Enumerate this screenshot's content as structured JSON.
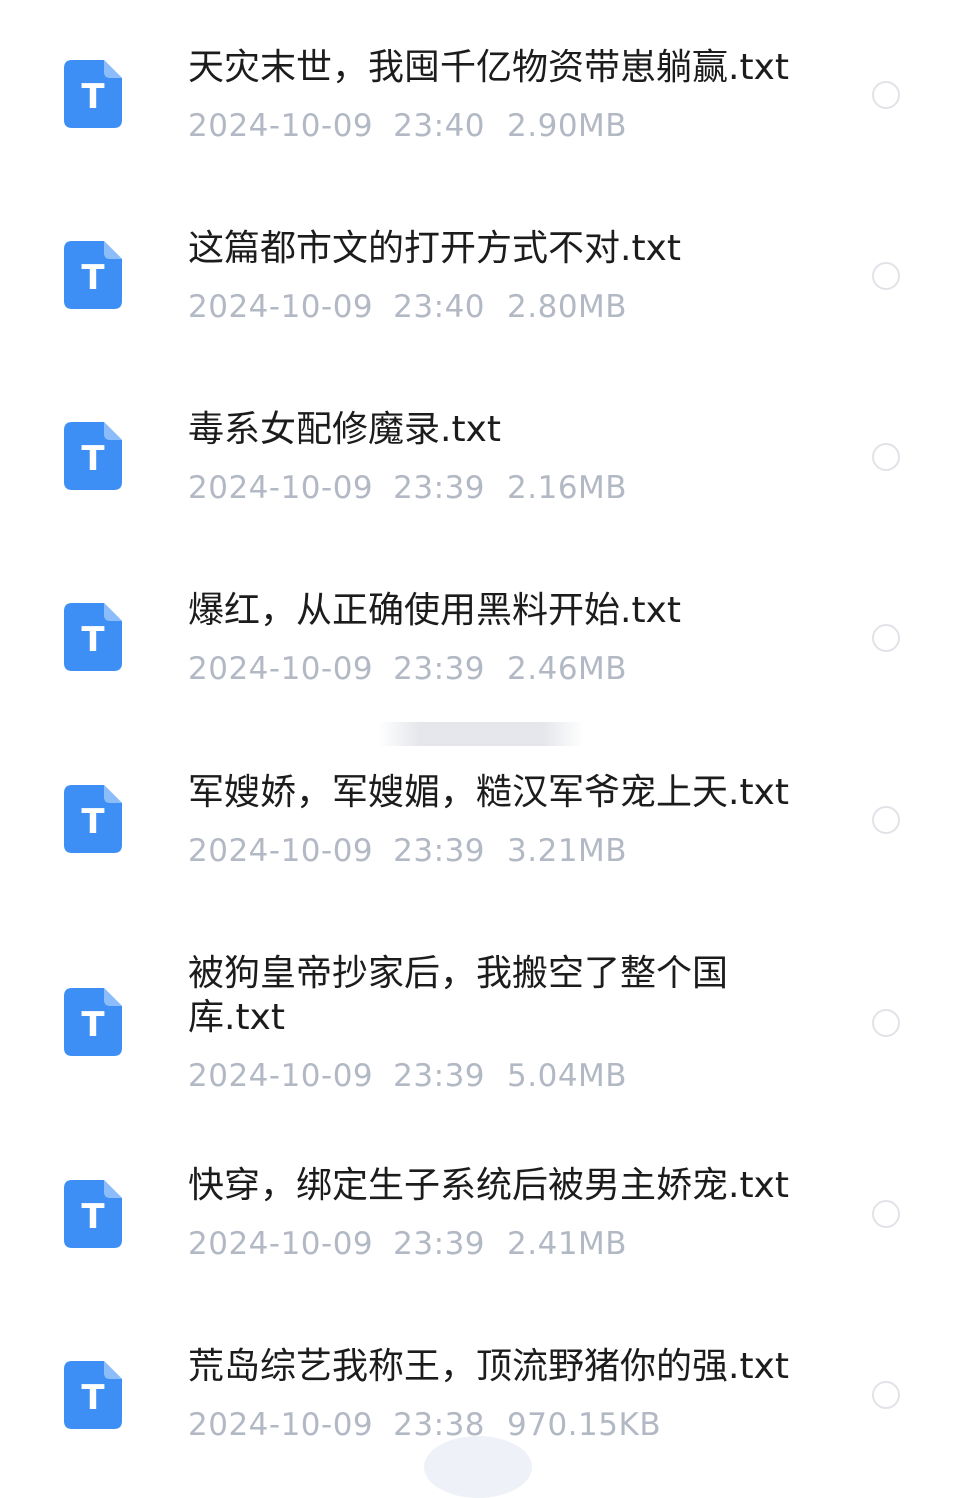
{
  "files": [
    {
      "name": "天灾末世，我囤千亿物资带崽躺赢.txt",
      "date": "2024-10-09",
      "time": "23:40",
      "size": "2.90MB",
      "icon": "txt-file-icon"
    },
    {
      "name": "这篇都市文的打开方式不对.txt",
      "date": "2024-10-09",
      "time": "23:40",
      "size": "2.80MB",
      "icon": "txt-file-icon"
    },
    {
      "name": "毒系女配修魔录.txt",
      "date": "2024-10-09",
      "time": "23:39",
      "size": "2.16MB",
      "icon": "txt-file-icon"
    },
    {
      "name": "爆红，从正确使用黑料开始.txt",
      "date": "2024-10-09",
      "time": "23:39",
      "size": "2.46MB",
      "icon": "txt-file-icon"
    },
    {
      "name": "军嫂娇，军嫂媚，糙汉军爷宠上天.txt",
      "date": "2024-10-09",
      "time": "23:39",
      "size": "3.21MB",
      "icon": "txt-file-icon"
    },
    {
      "name": "被狗皇帝抄家后，我搬空了整个国库.txt",
      "date": "2024-10-09",
      "time": "23:39",
      "size": "5.04MB",
      "icon": "txt-file-icon"
    },
    {
      "name": "快穿，绑定生子系统后被男主娇宠.txt",
      "date": "2024-10-09",
      "time": "23:39",
      "size": "2.41MB",
      "icon": "txt-file-icon"
    },
    {
      "name": "荒岛综艺我称王，顶流野猪你的强.txt",
      "date": "2024-10-09",
      "time": "23:38",
      "size": "970.15KB",
      "icon": "txt-file-icon"
    }
  ],
  "icon_glyph": "T",
  "colors": {
    "icon_blue": "#3d8ef5",
    "name_text": "#1c1c1c",
    "meta_text": "#b3b9c4",
    "radio_border": "#e1e3e8"
  }
}
